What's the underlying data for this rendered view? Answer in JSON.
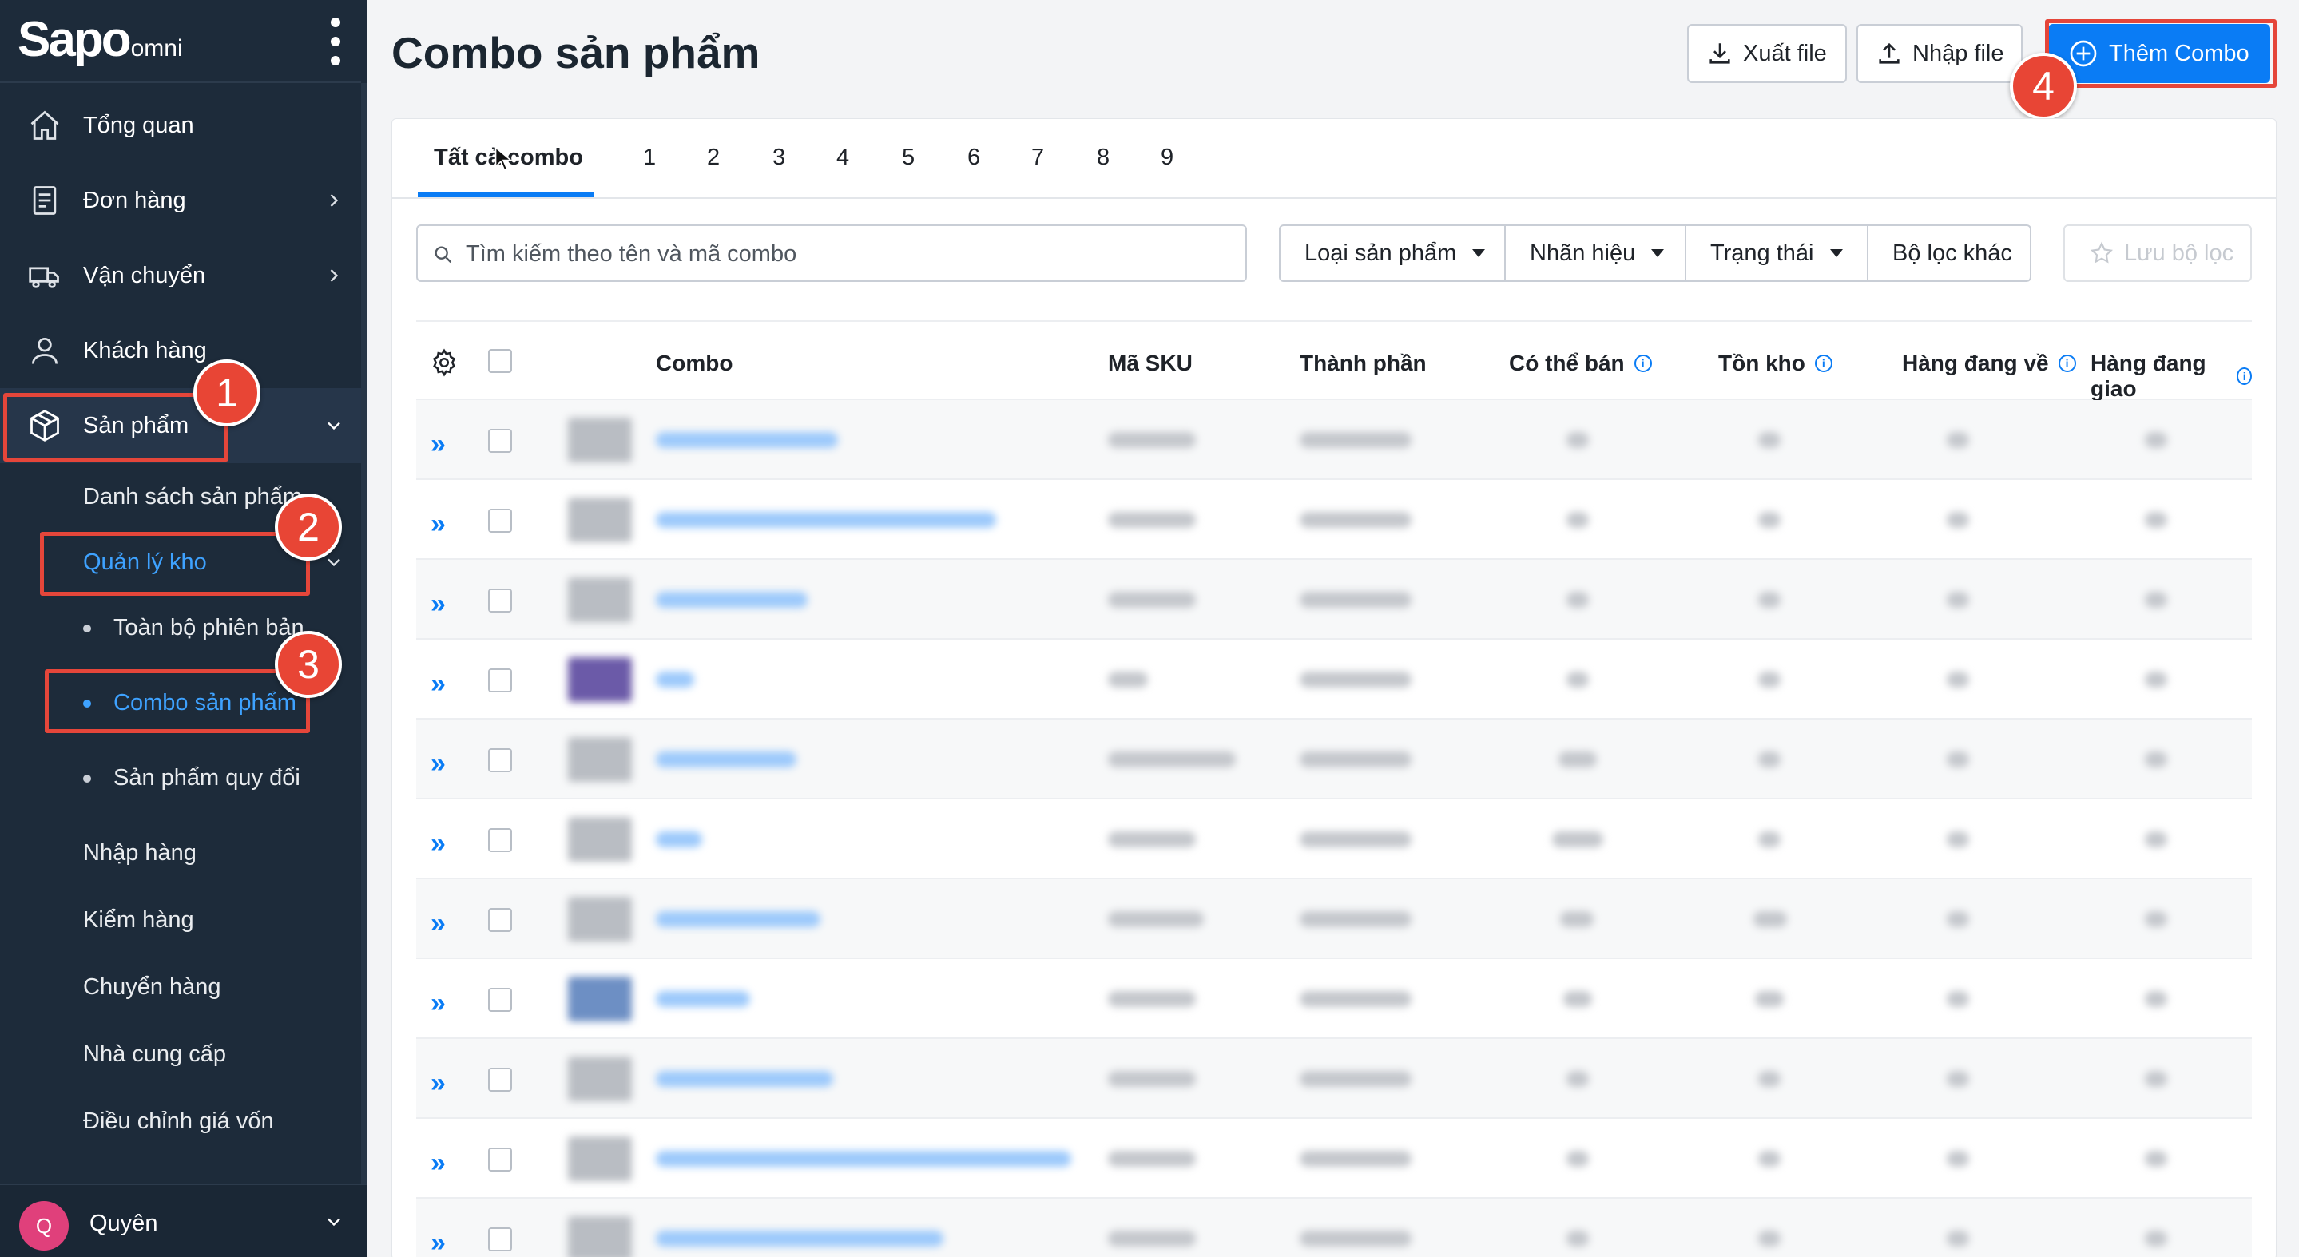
{
  "brand": {
    "name": "Sapo",
    "suffix": "omni"
  },
  "sidebar": {
    "items": [
      {
        "label": "Tổng quan"
      },
      {
        "label": "Đơn hàng"
      },
      {
        "label": "Vận chuyển"
      },
      {
        "label": "Khách hàng"
      },
      {
        "label": "Sản phẩm"
      }
    ],
    "product_sub": {
      "list": "Danh sách sản phẩm",
      "inventory": "Quản lý kho",
      "all_variants": "Toàn bộ phiên bản",
      "combo": "Combo sản phẩm",
      "converted": "Sản phẩm quy đổi",
      "import": "Nhập hàng",
      "check": "Kiểm hàng",
      "transfer": "Chuyển hàng",
      "supplier": "Nhà cung cấp",
      "cost_adjust": "Điều chỉnh giá vốn"
    },
    "user": {
      "initial": "Q",
      "name": "Quyên"
    }
  },
  "header": {
    "title": "Combo sản phẩm",
    "export_label": "Xuất file",
    "import_label": "Nhập file",
    "add_label": "Thêm Combo"
  },
  "tabs": [
    "Tất cả combo",
    "1",
    "2",
    "3",
    "4",
    "5",
    "6",
    "7",
    "8",
    "9"
  ],
  "filters": {
    "search_placeholder": "Tìm kiếm theo tên và mã combo",
    "product_type": "Loại sản phẩm",
    "brand": "Nhãn hiệu",
    "status": "Trạng thái",
    "other": "Bộ lọc khác",
    "save": "Lưu bộ lọc"
  },
  "table": {
    "columns": [
      "Combo",
      "Mã SKU",
      "Thành phần",
      "Có thể bán",
      "Tồn kho",
      "Hàng đang về",
      "Hàng đang giao"
    ]
  },
  "annotations": [
    "1",
    "2",
    "3",
    "4"
  ],
  "colors": {
    "sidebar": "#1d2b3a",
    "accent": "#0a7cf5",
    "annotation": "#e5463a"
  }
}
